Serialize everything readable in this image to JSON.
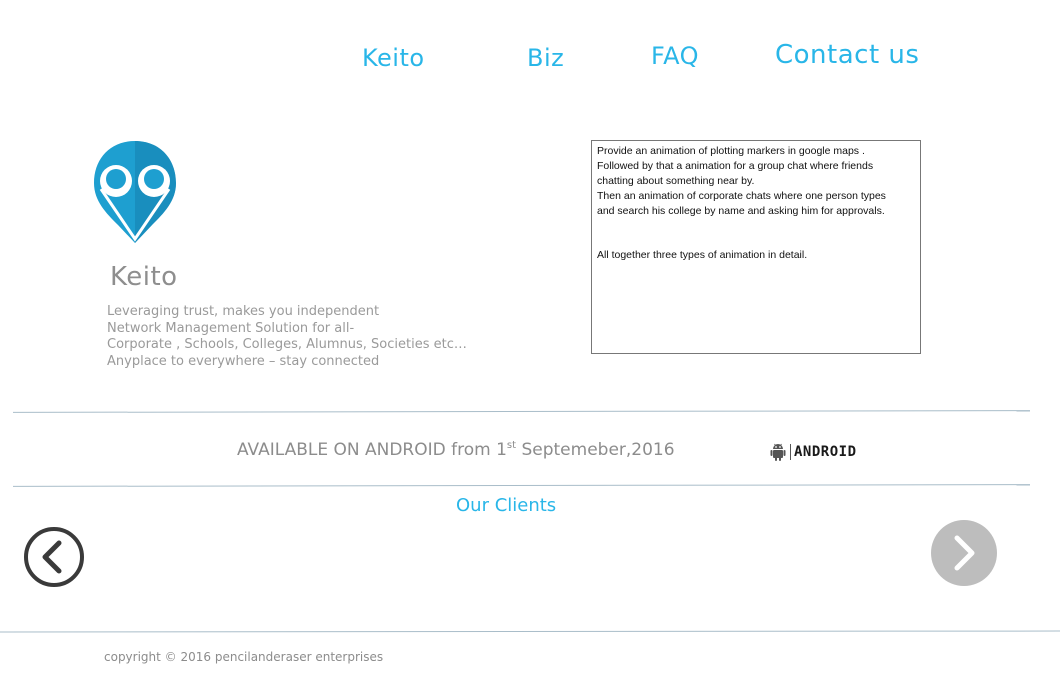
{
  "nav": {
    "items": [
      "Keito",
      "Biz",
      "FAQ",
      "Contact us"
    ]
  },
  "brand": {
    "name": "Keito",
    "tagline": [
      "Leveraging trust, makes you independent",
      "Network Management Solution for all-",
      "Corporate , Schools, Colleges, Alumnus, Societies etc…",
      "Anyplace to everywhere – stay connected"
    ]
  },
  "notes": {
    "para1": [
      "Provide an animation of plotting markers in google maps .",
      "Followed by that a animation for a group chat where friends",
      "chatting about something near by.",
      "Then an animation of corporate chats where one person types",
      "and search his college by name and asking him for approvals."
    ],
    "para2": "All together three types of animation in detail."
  },
  "availability": {
    "prefix": "AVAILABLE ON ANDROID from 1",
    "ordinal": "st",
    "suffix": " Septemeber,2016",
    "badge_text": "ANDROID",
    "badge_icon": "android-robot-icon"
  },
  "clients": {
    "title": "Our Clients",
    "prev_icon": "chevron-left-circle-icon",
    "next_icon": "chevron-right-circle-icon"
  },
  "footer": {
    "copyright": "copyright © 2016 pencilanderaser enterprises"
  },
  "colors": {
    "accent": "#29b6e8",
    "logo_blue": "#1e9fd0",
    "logo_dark": "#157fae",
    "text_gray": "#8c8c8c",
    "arrow_right_bg": "#bdbdbd",
    "arrow_left_stroke": "#3a3a3a"
  }
}
